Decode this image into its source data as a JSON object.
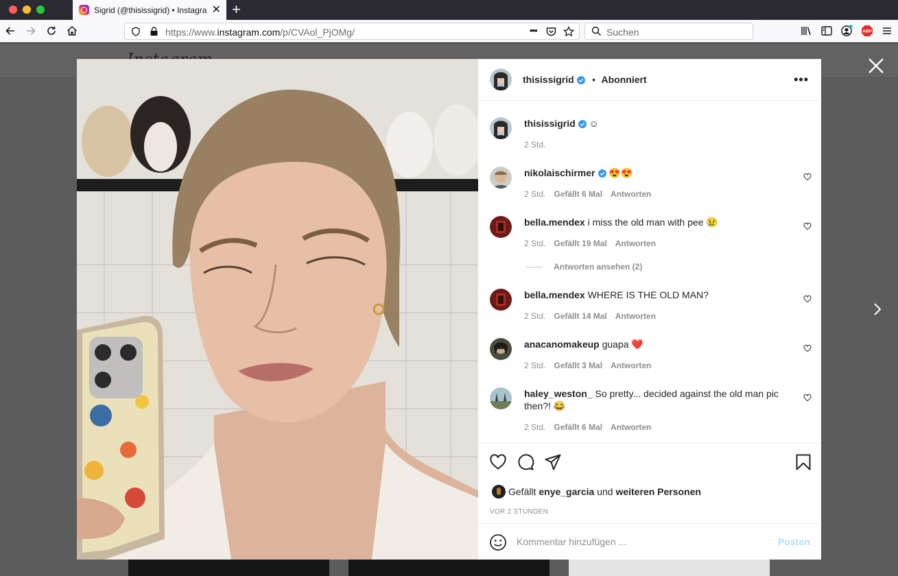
{
  "browser": {
    "tab_title": "Sigrid (@thisissigrid) • Instagra",
    "tab_close": "✕",
    "new_tab": "+",
    "url_prefix": "https://www.",
    "url_domain": "instagram.com",
    "url_path": "/p/CVAol_PjOMg/",
    "page_actions": "•••",
    "search_placeholder": "Suchen"
  },
  "background_page": {
    "logo": "Instagram"
  },
  "post": {
    "author": "thisissigrid",
    "separator": "•",
    "follow_state": "Abonniert",
    "more_options": "•••",
    "caption": {
      "username": "thisissigrid",
      "text": "☺",
      "time": "2 Std."
    },
    "comments": [
      {
        "username": "nikolaischirmer",
        "verified": true,
        "text": "😍😍",
        "time": "2 Std.",
        "likes": "Gefällt 6 Mal",
        "reply": "Antworten"
      },
      {
        "username": "bella.mendex",
        "verified": false,
        "text": "i miss the old man with pee 😢",
        "time": "2 Std.",
        "likes": "Gefällt 19 Mal",
        "reply": "Antworten"
      },
      {
        "username": "bella.mendex",
        "verified": false,
        "text": "WHERE IS THE OLD MAN?",
        "time": "2 Std.",
        "likes": "Gefällt 14 Mal",
        "reply": "Antworten"
      },
      {
        "username": "anacanomakeup",
        "verified": false,
        "text": "guapa ❤️",
        "time": "2 Std.",
        "likes": "Gefällt 3 Mal",
        "reply": "Antworten"
      },
      {
        "username": "haley_weston_",
        "verified": false,
        "text": "So pretty... decided against the old man pic then?! 😂",
        "time": "2 Std.",
        "likes": "Gefällt 6 Mal",
        "reply": "Antworten"
      }
    ],
    "view_replies": "Antworten ansehen (2)",
    "liked_by_prefix": "Gefällt",
    "liked_by_user": "enye_garcia",
    "liked_by_and": "und",
    "liked_by_others": "weiteren Personen",
    "posted_time": "VOR 2 STUNDEN",
    "comment_placeholder": "Kommentar hinzufügen ...",
    "post_button": "Posten"
  },
  "colors": {
    "verified_blue": "#3897f0",
    "post_button_disabled": "#b2dffc",
    "meta_gray": "#8e8e8e"
  },
  "icons": [
    "back-icon",
    "forward-icon",
    "reload-icon",
    "home-icon",
    "shield-icon",
    "lock-icon",
    "pocket-icon",
    "bookmark-star-icon",
    "search-icon",
    "library-icon",
    "sidebar-icon",
    "account-icon",
    "adblock-icon",
    "menu-icon",
    "close-icon",
    "next-arrow-icon",
    "more-icon",
    "heart-icon",
    "comment-icon",
    "share-icon",
    "save-icon",
    "emoji-icon"
  ]
}
